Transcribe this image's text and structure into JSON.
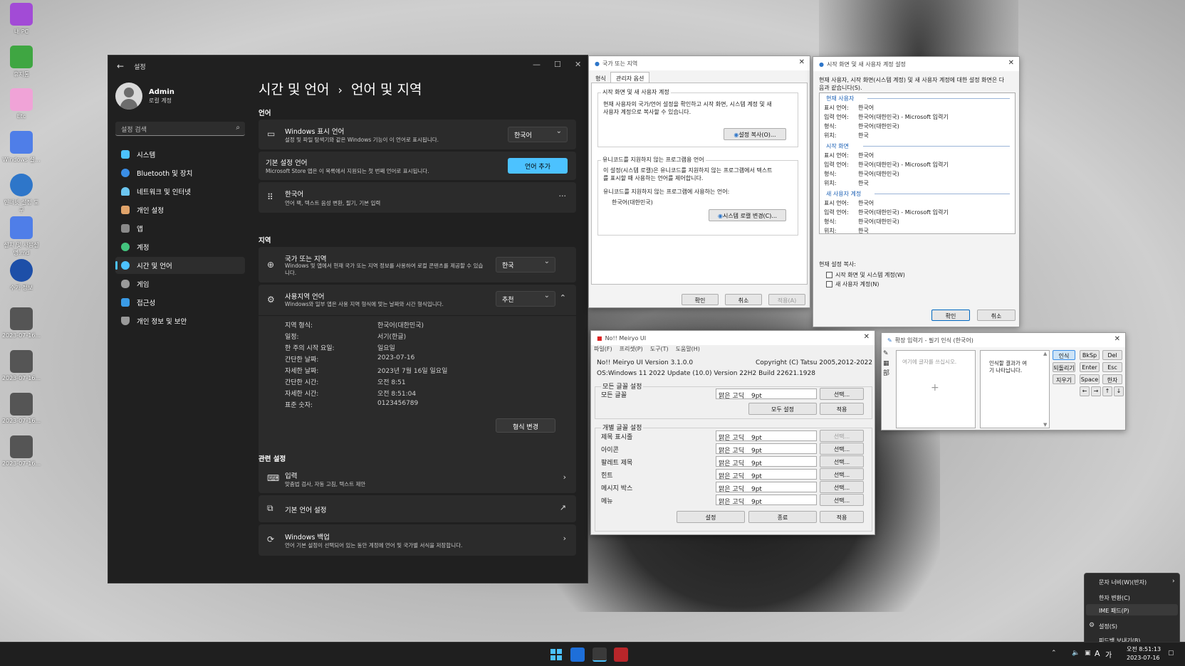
{
  "desktop": {
    "icons": [
      {
        "label": "내 PC",
        "color": "#a24bd6"
      },
      {
        "label": "휴지통",
        "color": "#3fa642"
      },
      {
        "label": "Etc",
        "color": "#f0a3d7"
      },
      {
        "label": "Windows 설...",
        "color": "#4f7ee8"
      },
      {
        "label": "인터넷 설정 도구",
        "color": "#2e76c9"
      },
      {
        "label": "설치 및 사용설명.md",
        "color": "#4f7ee8"
      },
      {
        "label": "수가 정보",
        "color": "#1d4fa8"
      },
      {
        "label": "2023-07-16...",
        "color": "#555555"
      },
      {
        "label": "2023-07-16...",
        "color": "#555555"
      },
      {
        "label": "2023-07-16...",
        "color": "#555555"
      },
      {
        "label": "2023-07-16...",
        "color": "#555555"
      }
    ]
  },
  "settings": {
    "window_title": "설정",
    "user_name": "Admin",
    "user_type": "로컬 계정",
    "search_placeholder": "설정 검색",
    "nav": [
      {
        "label": "시스템",
        "color": "#4cc2ff"
      },
      {
        "label": "Bluetooth 및 장치",
        "color": "#3a8ee6"
      },
      {
        "label": "네트워크 및 인터넷",
        "color": "#6cc6f0"
      },
      {
        "label": "개인 설정",
        "color": "#e0a36a"
      },
      {
        "label": "앱",
        "color": "#8a8a8a"
      },
      {
        "label": "계정",
        "color": "#43c47e"
      },
      {
        "label": "시간 및 언어",
        "color": "#4cc2ff"
      },
      {
        "label": "게임",
        "color": "#9a9a9a"
      },
      {
        "label": "접근성",
        "color": "#3a9be6"
      },
      {
        "label": "개인 정보 및 보안",
        "color": "#9a9a9a"
      }
    ],
    "breadcrumb_parent": "시간 및 언어",
    "breadcrumb_sep": "›",
    "breadcrumb_current": "언어 및 지역",
    "section_language": "언어",
    "display_lang_title": "Windows 표시 언어",
    "display_lang_desc": "설정 및 파일 탐색기와 같은 Windows 기능이 이 언어로 표시됩니다.",
    "display_lang_value": "한국어",
    "pref_lang_title": "기본 설정 언어",
    "pref_lang_desc": "Microsoft Store 앱은 이 목록에서 지원되는 첫 번째 언어로 표시됩니다.",
    "add_lang_button": "언어 추가",
    "lang_item_title": "한국어",
    "lang_item_desc": "언어 팩, 텍스트 음성 변환, 필기, 기본 입력",
    "more_icon": "···",
    "section_region": "지역",
    "country_title": "국가 또는 지역",
    "country_desc": "Windows 및 앱에서 현재 국가 또는 지역 정보를 사용하여 로컬 콘텐츠를 제공할 수 있습니다.",
    "country_value": "한국",
    "regional_title": "사용지역 언어",
    "regional_desc": "Windows와 일부 앱은 사용 지역 형식에 맞는 날짜와 시간 형식입니다.",
    "regional_value": "추천",
    "formats": [
      {
        "k": "지역 형식:",
        "v": "한국어(대한민국)"
      },
      {
        "k": "일정:",
        "v": "서기(한글)"
      },
      {
        "k": "한 주의 시작 요일:",
        "v": "일요일"
      },
      {
        "k": "간단한 날짜:",
        "v": "2023-07-16"
      },
      {
        "k": "자세한 날짜:",
        "v": "2023년 7월 16일 일요일"
      },
      {
        "k": "간단한 시간:",
        "v": "오전 8:51"
      },
      {
        "k": "자세한 시간:",
        "v": "오전 8:51:04"
      },
      {
        "k": "표준 숫자:",
        "v": "0123456789"
      }
    ],
    "change_format_button": "형식 변경",
    "section_related": "관련 설정",
    "input_title": "입력",
    "input_desc": "맞춤법 검사, 자동 고침, 텍스트 제안",
    "admin_lang_title": "기본 언어 설정",
    "backup_title": "Windows 백업",
    "backup_desc": "언어 기본 설정이 선택되어 있는 동안 계정에 언어 및 국가별 서식을 저장합니다."
  },
  "region_dialog": {
    "title": "국가 또는 지역",
    "tabs": [
      "형식",
      "관리자 옵션"
    ],
    "group1_title": "시작 화면 및 새 사용자 계정",
    "group1_text": [
      "현재 사용자의 국가/언어 설정을 확인하고 시작 화면, 시스템 계정 및 새",
      "사용자 계정으로 복사할 수 있습니다."
    ],
    "copy_button": "설정 복사(O)...",
    "group2_title": "유니코드를 지원하지 않는 프로그램용 언어",
    "group2_text": [
      "이 설정(시스템 로캘)은 유니코드를 지원하지 않는 프로그램에서 텍스트",
      "를 표시할 때 사용하는 언어를 제어합니다."
    ],
    "current_label": "유니코드를 지원하지 않는 프로그램에 사용하는 언어:",
    "current_value": "한국어(대한민국)",
    "locale_button": "시스템 로캘 변경(C)...",
    "ok": "확인",
    "cancel": "취소",
    "apply": "적용(A)"
  },
  "copy_dialog": {
    "title": "시작 화면 및 새 사용자 계정 설정",
    "intro": [
      "현재 사용자, 시작 화면(시스템 계정) 및 새 사용자 계정에 대한 설정 화면은 다",
      "음과 같습니다(S)."
    ],
    "sections": [
      {
        "title": "현재 사용자",
        "rows": [
          {
            "k": "표시 언어:",
            "v": "한국어"
          },
          {
            "k": "입력 언어:",
            "v": "한국어(대한민국) - Microsoft 입력기"
          },
          {
            "k": "형식:",
            "v": "한국어(대한민국)"
          },
          {
            "k": "위치:",
            "v": "한국"
          }
        ]
      },
      {
        "title": "시작 화면",
        "rows": [
          {
            "k": "표시 언어:",
            "v": "한국어"
          },
          {
            "k": "입력 언어:",
            "v": "한국어(대한민국) - Microsoft 입력기"
          },
          {
            "k": "형식:",
            "v": "한국어(대한민국)"
          },
          {
            "k": "위치:",
            "v": "한국"
          }
        ]
      },
      {
        "title": "새 사용자 계정",
        "rows": [
          {
            "k": "표시 언어:",
            "v": "한국어"
          },
          {
            "k": "입력 언어:",
            "v": "한국어(대한민국) - Microsoft 입력기"
          },
          {
            "k": "형식:",
            "v": "한국어(대한민국)"
          },
          {
            "k": "위치:",
            "v": "한국"
          }
        ]
      }
    ],
    "copy_label": "현재 설정 복사:",
    "check1": "시작 화면 및 시스템 계정(W)",
    "check2": "새 사용자 계정(N)",
    "ok": "확인",
    "cancel": "취소"
  },
  "meiryo": {
    "title": "No!! Meiryo UI",
    "menu": [
      "파일(F)",
      "프리셋(P)",
      "도구(T)",
      "도움말(H)"
    ],
    "version": "No!! Meiryo UI Version 3.1.0.0",
    "copyright": "Copyright (C) Tatsu 2005,2012-2022",
    "os": "OS:Windows 11 2022 Update (10.0) Version 22H2 Build 22621.1928",
    "all_group": "모든 글꼴 설정",
    "all_label": "모든 글꼴",
    "all_font": "맑은 고딕",
    "all_size": "9pt",
    "select": "선택...",
    "all_set": "모두 설정",
    "apply": "적용",
    "indiv_group": "개별 글꼴 설정",
    "rows": [
      {
        "label": "제목 표시줄",
        "font": "맑은 고딕",
        "size": "9pt"
      },
      {
        "label": "아이콘",
        "font": "맑은 고딕",
        "size": "9pt"
      },
      {
        "label": "팔레트 제목",
        "font": "맑은 고딕",
        "size": "9pt"
      },
      {
        "label": "힌트",
        "font": "맑은 고딕",
        "size": "9pt"
      },
      {
        "label": "메시지 박스",
        "font": "맑은 고딕",
        "size": "9pt"
      },
      {
        "label": "메뉴",
        "font": "맑은 고딕",
        "size": "9pt"
      }
    ],
    "set": "설정",
    "close": "종료",
    "apply2": "적용"
  },
  "ime_pad": {
    "title": "확장 입력기 - 필기 인식 (한국어)",
    "write_hint": "여기에 글자를 쓰십시오.",
    "result_hint": [
      "인식할 결과가 여",
      "기 나타납니다."
    ],
    "buttons": [
      "인식",
      "되돌리기",
      "지우기"
    ],
    "keys": [
      "BkSp",
      "Del",
      "Enter",
      "Esc",
      "Space",
      "한자"
    ],
    "arrows": [
      "←",
      "→",
      "↑",
      "↓"
    ]
  },
  "context_menu": {
    "items": [
      "문자 너비(W)(반자)",
      "한자 변환(C)",
      "IME 패드(P)",
      "설정(S)",
      "피드백 보내기(B)"
    ]
  },
  "taskbar": {
    "time": "오전 8:51:13",
    "date": "2023-07-16",
    "ime_mode": "A",
    "ime_lang": "가"
  }
}
